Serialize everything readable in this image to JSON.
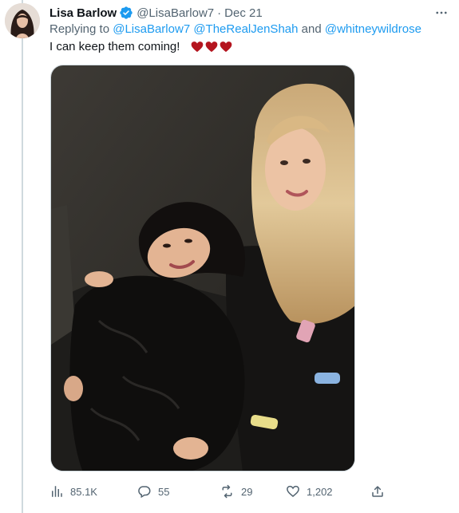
{
  "tweet": {
    "author_name": "Lisa Barlow",
    "handle": "@LisaBarlow7",
    "separator": "·",
    "date": "Dec 21",
    "replying_prefix": "Replying to",
    "mentions": [
      "@LisaBarlow7",
      "@TheRealJenShah",
      "@whitneywildrose"
    ],
    "mentions_joiner": "and",
    "text": "I can keep them coming!",
    "emoji": "heart-icon x3",
    "media_description": "photo"
  },
  "actions": {
    "views": "85.1K",
    "replies": "55",
    "retweets": "29",
    "likes": "1,202"
  },
  "colors": {
    "link": "#1d9bf0",
    "secondary_text": "#536471",
    "primary_text": "#0f1419",
    "verified": "#1d9bf0",
    "heart": "#b4151f"
  }
}
